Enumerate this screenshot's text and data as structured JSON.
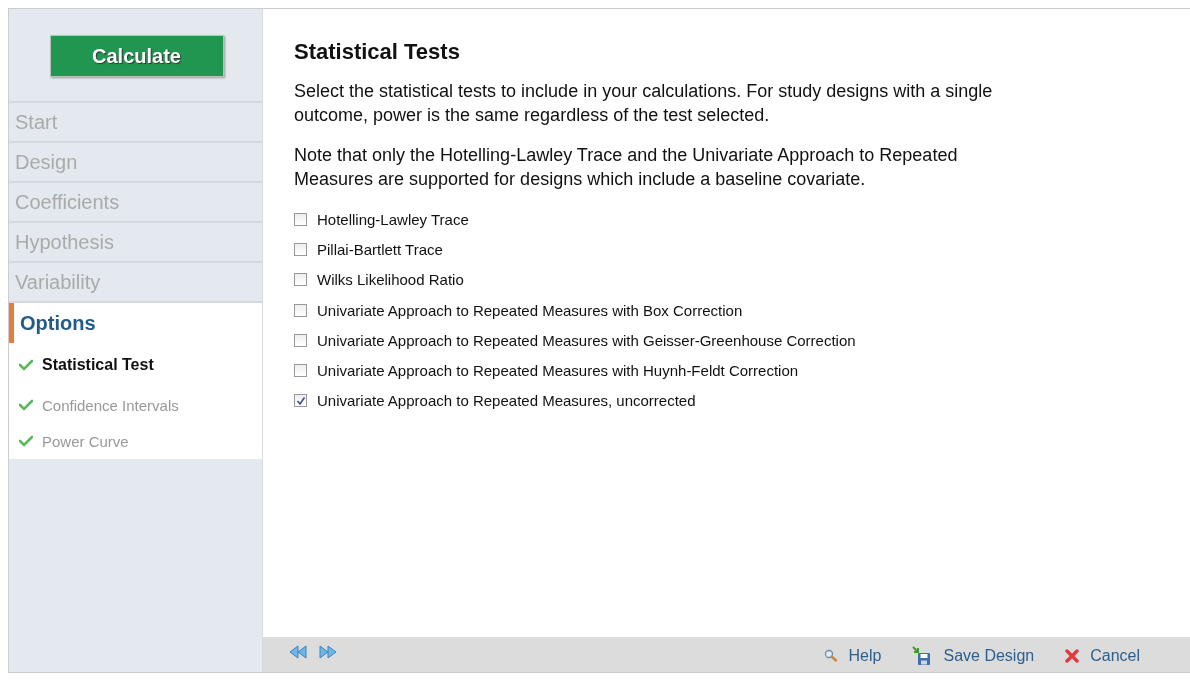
{
  "sidebar": {
    "calculate_button": "Calculate",
    "steps": [
      {
        "label": "Start",
        "active": false
      },
      {
        "label": "Design",
        "active": false
      },
      {
        "label": "Coefficients",
        "active": false
      },
      {
        "label": "Hypothesis",
        "active": false
      },
      {
        "label": "Variability",
        "active": false
      },
      {
        "label": "Options",
        "active": true,
        "children": [
          {
            "label": "Statistical Test",
            "selected": true,
            "completed": true
          },
          {
            "label": "Confidence Intervals",
            "selected": false,
            "completed": true
          },
          {
            "label": "Power Curve",
            "selected": false,
            "completed": true
          }
        ]
      }
    ]
  },
  "content": {
    "title": "Statistical Tests",
    "paragraphs": [
      "Select the statistical tests to include in your calculations. For study designs with a single outcome, power is the same regardless of the test selected.",
      "Note that only the Hotelling-Lawley Trace and the Univariate Approach to Repeated Measures are supported for designs which include a baseline covariate."
    ],
    "tests": [
      {
        "label": "Hotelling-Lawley Trace",
        "checked": false
      },
      {
        "label": "Pillai-Bartlett Trace",
        "checked": false
      },
      {
        "label": "Wilks Likelihood Ratio",
        "checked": false
      },
      {
        "label": "Univariate Approach to Repeated Measures with Box Correction",
        "checked": false
      },
      {
        "label": "Univariate Approach to Repeated Measures with Geisser-Greenhouse Correction",
        "checked": false
      },
      {
        "label": "Univariate Approach to Repeated Measures with Huynh-Feldt Correction",
        "checked": false
      },
      {
        "label": "Univariate Approach to Repeated Measures, uncorrected",
        "checked": true
      }
    ]
  },
  "footer": {
    "actions": [
      {
        "kind": "help",
        "label": "Help"
      },
      {
        "kind": "save",
        "label": "Save Design"
      },
      {
        "kind": "cancel",
        "label": "Cancel"
      }
    ]
  }
}
